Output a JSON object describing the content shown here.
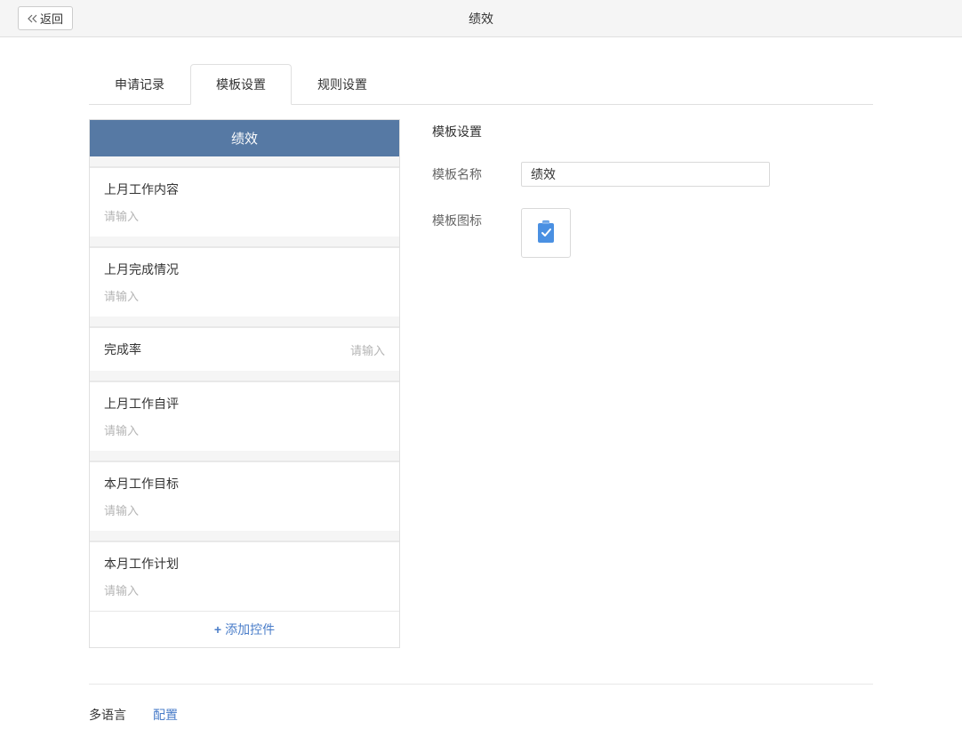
{
  "header": {
    "back_label": "返回",
    "page_title": "绩效"
  },
  "tabs": [
    {
      "label": "申请记录"
    },
    {
      "label": "模板设置"
    },
    {
      "label": "规则设置"
    }
  ],
  "form_builder": {
    "title": "绩效",
    "fields": [
      {
        "label": "上月工作内容",
        "placeholder": "请输入",
        "type": "textarea"
      },
      {
        "label": "上月完成情况",
        "placeholder": "请输入",
        "type": "textarea"
      },
      {
        "label": "完成率",
        "placeholder": "请输入",
        "type": "inline"
      },
      {
        "label": "上月工作自评",
        "placeholder": "请输入",
        "type": "textarea"
      },
      {
        "label": "本月工作目标",
        "placeholder": "请输入",
        "type": "textarea"
      },
      {
        "label": "本月工作计划",
        "placeholder": "请输入",
        "type": "textarea"
      }
    ],
    "add_control_label": "添加控件"
  },
  "settings": {
    "title": "模板设置",
    "name_label": "模板名称",
    "name_value": "绩效",
    "icon_label": "模板图标"
  },
  "multilang": {
    "label": "多语言",
    "config_label": "配置"
  }
}
